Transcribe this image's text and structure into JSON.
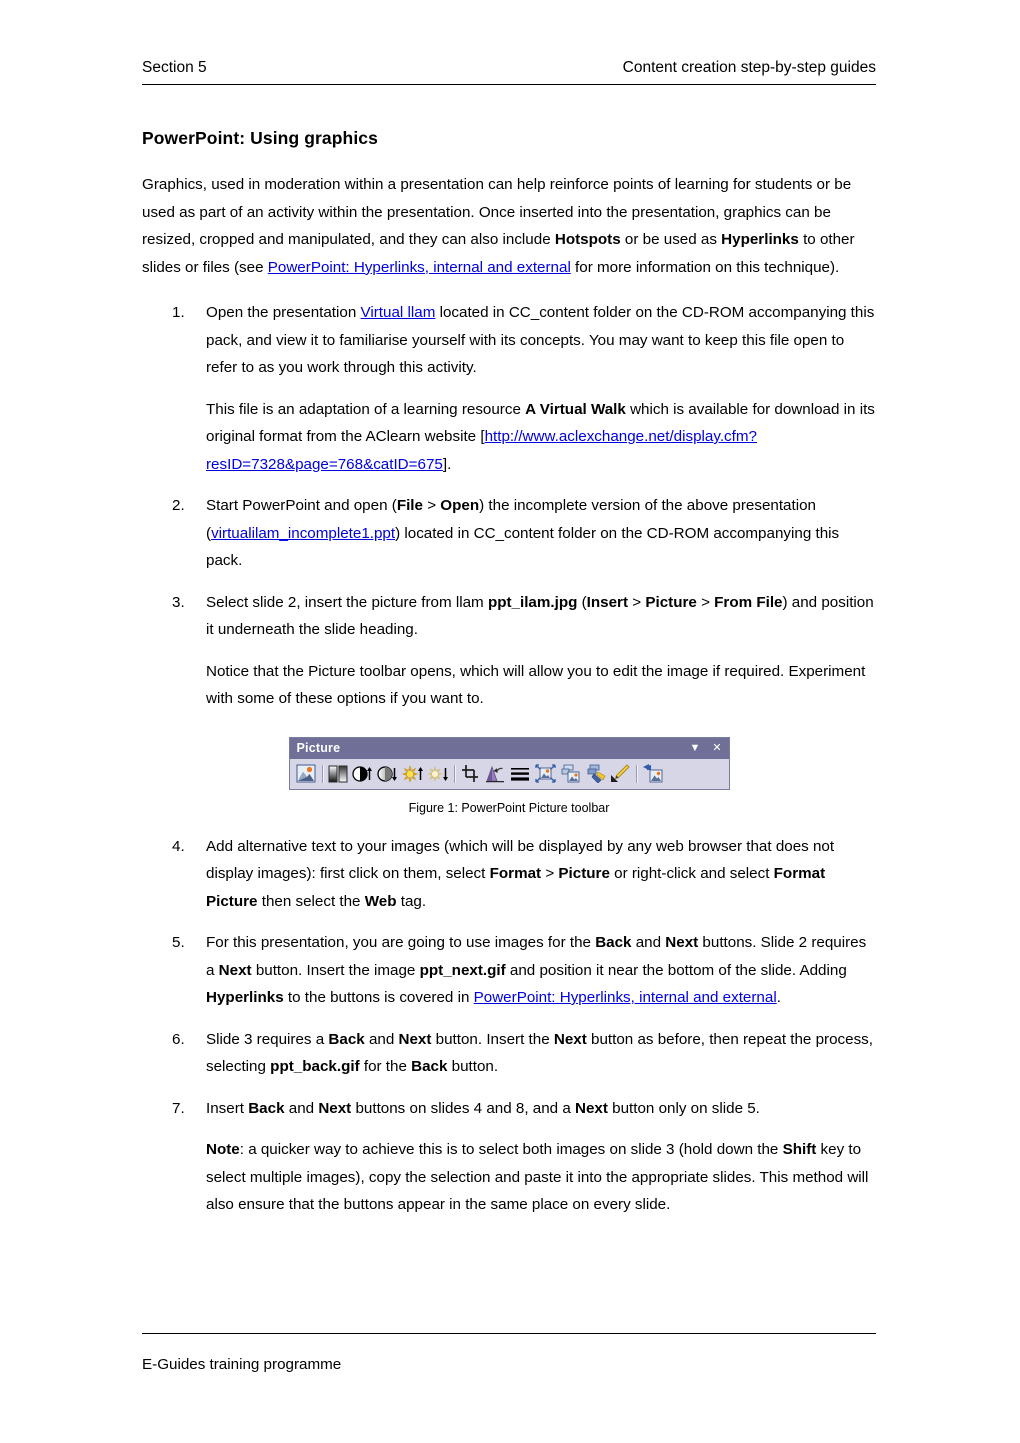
{
  "header": {
    "left": "Section 5",
    "right": "Content creation step-by-step guides"
  },
  "title": "PowerPoint: Using graphics",
  "intro": {
    "p1_a": "Graphics, used in moderation within a presentation can help reinforce points of learning for students or be used as part of an activity within the presentation. Once inserted into the presentation, graphics can be resized, cropped and manipulated, and they can also include ",
    "p1_b_hotspots": "Hotspots",
    "p1_c": " or be used as ",
    "p1_d_hyperlinks": "Hyperlinks",
    "p1_e": " to other slides or files (see ",
    "p1_link": "PowerPoint: Hyperlinks, internal and external",
    "p1_f": " for more information on this technique)."
  },
  "steps": [
    {
      "marker": "1.",
      "p1_a": "Open the presentation ",
      "p1_link": "Virtual llam",
      "p1_b": " located in CC_content folder on the CD-ROM accompanying this pack, and view it to familiarise yourself with its concepts. You may want to keep this file open to refer to as you work through this activity.",
      "p2_a": "This file is an adaptation of a learning resource ",
      "p2_bold": "A Virtual Walk",
      "p2_b": " which is available for download in its original format from the AClearn website [",
      "p2_link": "http://www.aclexchange.net/display.cfm?resID=7328&page=768&catID=675",
      "p2_c": "]."
    },
    {
      "marker": "2.",
      "p1_a": "Start PowerPoint and open (",
      "p1_bold1": "File",
      "p1_b": " > ",
      "p1_bold2": "Open",
      "p1_c": ") the incomplete version of the above presentation (",
      "p1_link": "virtualilam_incomplete1.ppt",
      "p1_d": ") located in CC_content folder on the CD-ROM accompanying this pack."
    },
    {
      "marker": "3.",
      "p1_a": "Select slide 2, insert the picture from llam ",
      "p1_bold1": "ppt_ilam.jpg",
      "p1_b": " (",
      "p1_bold2": "Insert",
      "p1_c": " > ",
      "p1_bold3": "Picture",
      "p1_d": " > ",
      "p1_bold4": "From File",
      "p1_e": ") and position it underneath the slide heading.",
      "p2": "Notice that the Picture toolbar opens, which will allow you to edit the image if required. Experiment with some of these options if you want to."
    },
    {
      "marker": "4.",
      "p1_a": "Add alternative text to your images (which will be displayed by any web browser that does not display images): first click on them, select ",
      "p1_bold1": "Format",
      "p1_b": " > ",
      "p1_bold2": "Picture",
      "p1_c": " or right-click and select ",
      "p1_bold3": "Format Picture",
      "p1_d": " then select the ",
      "p1_bold4": "Web",
      "p1_e": " tag."
    },
    {
      "marker": "5.",
      "p1_a": "For this presentation, you are going to use images for the ",
      "p1_bold1": "Back",
      "p1_b": " and ",
      "p1_bold2": "Next",
      "p1_c": " buttons. Slide 2 requires a ",
      "p1_bold3": "Next",
      "p1_d": " button. Insert the image ",
      "p1_bold4": "ppt_next.gif",
      "p1_e": " and position it near the bottom of the slide. Adding ",
      "p1_bold5": "Hyperlinks",
      "p1_f": " to the buttons is covered in ",
      "p1_link": "PowerPoint: Hyperlinks, internal and external",
      "p1_g": "."
    },
    {
      "marker": "6.",
      "p1_a": "Slide 3 requires a ",
      "p1_bold1": "Back",
      "p1_b": " and ",
      "p1_bold2": "Next",
      "p1_c": " button. Insert the ",
      "p1_bold3": "Next",
      "p1_d": " button as before, then repeat the process, selecting ",
      "p1_bold4": "ppt_back.gif",
      "p1_e": " for the ",
      "p1_bold5": "Back",
      "p1_f": " button."
    },
    {
      "marker": "7.",
      "p1_a": "Insert ",
      "p1_bold1": "Back",
      "p1_b": " and ",
      "p1_bold2": "Next",
      "p1_c": " buttons on slides 4 and 8, and a ",
      "p1_bold3": "Next",
      "p1_d": " button only on slide 5.",
      "p2_bold1": "Note",
      "p2_a": ": a quicker way to achieve this is to select both images on slide 3 (hold down the ",
      "p2_bold2": "Shift",
      "p2_b": " key to select multiple images), copy the selection and paste it into the appropriate slides. This method will also ensure that the buttons appear in the same place on every slide."
    }
  ],
  "figure": {
    "toolbar_title": "Picture",
    "dropdown_glyph": "▼",
    "close_glyph": "✕",
    "caption": "Figure 1: PowerPoint Picture toolbar",
    "title_bar_color": "#6f6f97",
    "body_color": "#d6d6e7",
    "icons": [
      "insert-picture-icon",
      "separator",
      "color-icon",
      "more-contrast-icon",
      "less-contrast-icon",
      "more-brightness-icon",
      "less-brightness-icon",
      "separator",
      "crop-icon",
      "rotate-left-icon",
      "line-style-icon",
      "compress-pictures-icon",
      "recolor-picture-icon",
      "format-picture-icon",
      "set-transparent-color-icon",
      "separator",
      "reset-picture-icon"
    ]
  },
  "footer": {
    "text": "E-Guides training programme"
  }
}
